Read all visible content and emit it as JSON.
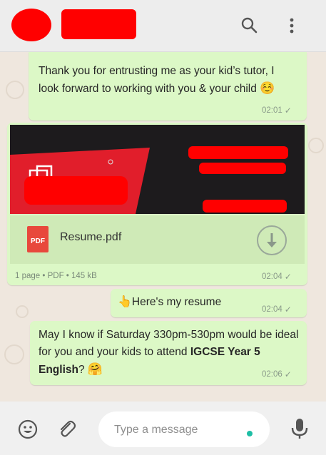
{
  "messages": [
    {
      "text": "Thank you for entrusting me as your kid’s tutor, I look forward to working with you & your child",
      "emoji": "☺️",
      "time": "02:01"
    },
    {
      "type": "document",
      "filename": "Resume.pdf",
      "file_icon_label": "PDF",
      "meta": "1 page • PDF • 145 kB",
      "time": "02:04"
    },
    {
      "emoji": "👆",
      "text": "Here's my resume",
      "time": "02:04"
    },
    {
      "text_before": "May I know if Saturday 330pm-530pm would be ideal for you and your kids to attend ",
      "text_bold": "IGCSE Year 5 English",
      "text_after": "?",
      "emoji": "🤗",
      "time": "02:06"
    }
  ],
  "composer": {
    "placeholder": "Type a message"
  },
  "icons": {
    "header": [
      "search-icon",
      "more-vertical-icon"
    ],
    "footer": [
      "emoji-icon",
      "attach-icon",
      "mic-icon"
    ]
  },
  "colors": {
    "outgoing_bubble": "#dcf8c6",
    "chat_background": "#efe7de",
    "redaction": "#ff0000"
  }
}
